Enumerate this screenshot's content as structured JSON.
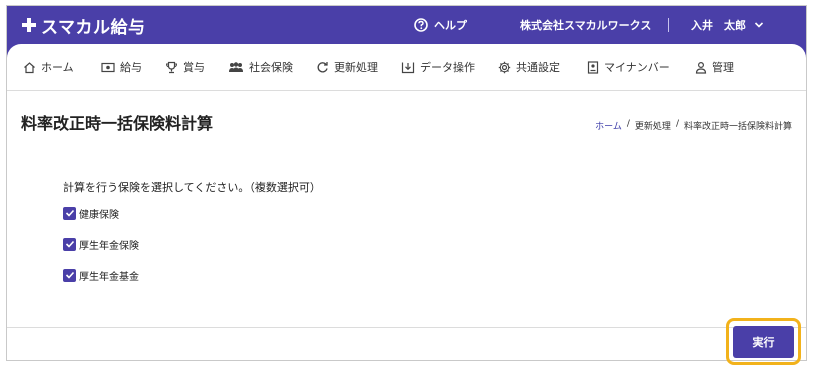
{
  "app": {
    "logo_text": "スマカル給与",
    "help_label": "ヘルプ",
    "company_name": "株式会社スマカルワークス",
    "user_name": "入井　太郎"
  },
  "nav": {
    "items": [
      {
        "label": "ホーム",
        "icon": "home-icon"
      },
      {
        "label": "給与",
        "icon": "salary-icon"
      },
      {
        "label": "賞与",
        "icon": "trophy-icon"
      },
      {
        "label": "社会保険",
        "icon": "people-icon"
      },
      {
        "label": "更新処理",
        "icon": "refresh-icon"
      },
      {
        "label": "データ操作",
        "icon": "download-icon"
      },
      {
        "label": "共通設定",
        "icon": "gear-icon"
      },
      {
        "label": "マイナンバー",
        "icon": "id-card-icon"
      },
      {
        "label": "管理",
        "icon": "user-icon"
      }
    ]
  },
  "page": {
    "title": "料率改正時一括保険料計算",
    "breadcrumb": {
      "home": "ホーム",
      "sep": "/",
      "parent": "更新処理",
      "current": "料率改正時一括保険料計算"
    },
    "prompt": "計算を行う保険を選択してください。（複数選択可）",
    "options": [
      {
        "label": "健康保険",
        "checked": true
      },
      {
        "label": "厚生年金保険",
        "checked": true
      },
      {
        "label": "厚生年金基金",
        "checked": true
      }
    ],
    "execute_label": "実行"
  },
  "colors": {
    "brand": "#4a3fa8",
    "highlight": "#f2b21b"
  }
}
